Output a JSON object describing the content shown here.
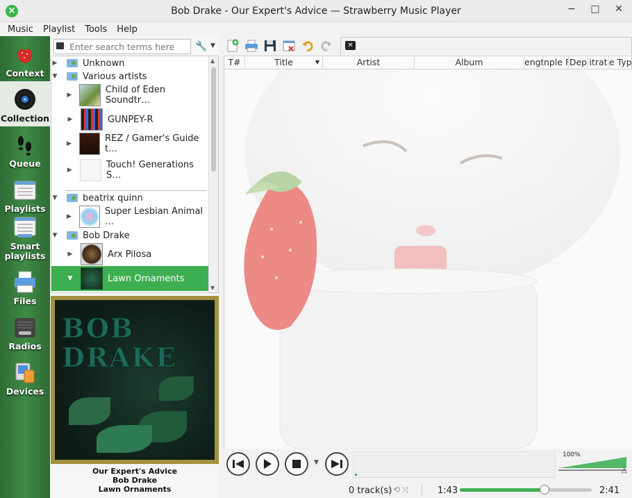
{
  "window": {
    "title": "Bob Drake - Our Expert's Advice — Strawberry Music Player"
  },
  "menu": [
    "Music",
    "Playlist",
    "Tools",
    "Help"
  ],
  "sidebar": {
    "items": [
      {
        "label": "Context",
        "icon": "strawberry-icon"
      },
      {
        "label": "Collection",
        "icon": "vinyl-icon",
        "active": true
      },
      {
        "label": "Queue",
        "icon": "footprints-icon"
      },
      {
        "label": "Playlists",
        "icon": "playlist-icon"
      },
      {
        "label": "Smart playlists",
        "icon": "smart-playlist-icon"
      },
      {
        "label": "Files",
        "icon": "printer-files-icon"
      },
      {
        "label": "Radios",
        "icon": "radio-icon"
      },
      {
        "label": "Devices",
        "icon": "devices-icon"
      }
    ]
  },
  "collection": {
    "search_placeholder": "Enter search terms here",
    "tree": [
      {
        "label": "Unknown",
        "type": "folder",
        "expanded": false
      },
      {
        "label": "Various artists",
        "type": "folder",
        "expanded": true
      },
      {
        "label": "Child of Eden Soundtr…",
        "type": "album"
      },
      {
        "label": "GUNPEY-R",
        "type": "album"
      },
      {
        "label": "REZ / Gamer's Guide t…",
        "type": "album"
      },
      {
        "label": "Touch! Generations S…",
        "type": "album"
      },
      {
        "label": "beatrix quinn",
        "type": "folder",
        "expanded": true
      },
      {
        "label": "Super Lesbian Animal …",
        "type": "album"
      },
      {
        "label": "Bob Drake",
        "type": "folder",
        "expanded": true
      },
      {
        "label": "Arx Pilosa",
        "type": "album"
      },
      {
        "label": "Lawn Ornaments",
        "type": "album",
        "selected": true
      }
    ]
  },
  "now_playing": {
    "art_text": "BOB DRAKE",
    "title": "Our Expert's Advice",
    "artist": "Bob Drake",
    "album": "Lawn Ornaments"
  },
  "playlist": {
    "columns": [
      "T#",
      "Title",
      "Artist",
      "Album",
      "engt",
      "nple F",
      "Dep",
      "itrat",
      "e Typ"
    ]
  },
  "player": {
    "volume_label": "100%",
    "volume_level": 1.0,
    "track_count": "0 track(s)",
    "elapsed": "1:43",
    "total": "2:41",
    "progress": 0.64
  },
  "colors": {
    "accent": "#3daf52",
    "sidebar": "#3e8a46"
  }
}
